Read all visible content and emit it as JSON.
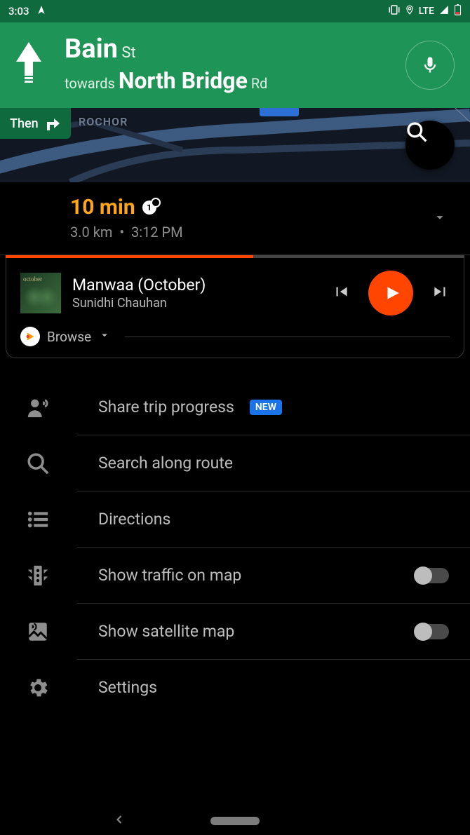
{
  "status": {
    "time": "3:03",
    "net": "LTE"
  },
  "nav": {
    "street_main": "Bain",
    "street_suffix": "St",
    "towards_prefix": "towards",
    "towards_main": "North Bridge",
    "towards_suffix": "Rd",
    "then_label": "Then"
  },
  "map": {
    "area": "ROCHOR"
  },
  "trip": {
    "eta_value": "10",
    "eta_unit": "min",
    "distance": "3.0 km",
    "sep": "•",
    "arrival": "3:12 PM"
  },
  "media": {
    "album_text": "october",
    "track": "Manwaa (October)",
    "artist": "Sunidhi Chauhan",
    "browse": "Browse"
  },
  "menu": {
    "share": "Share trip progress",
    "new_badge": "NEW",
    "search": "Search along route",
    "directions": "Directions",
    "traffic": "Show traffic on map",
    "satellite": "Show satellite map",
    "settings": "Settings"
  }
}
